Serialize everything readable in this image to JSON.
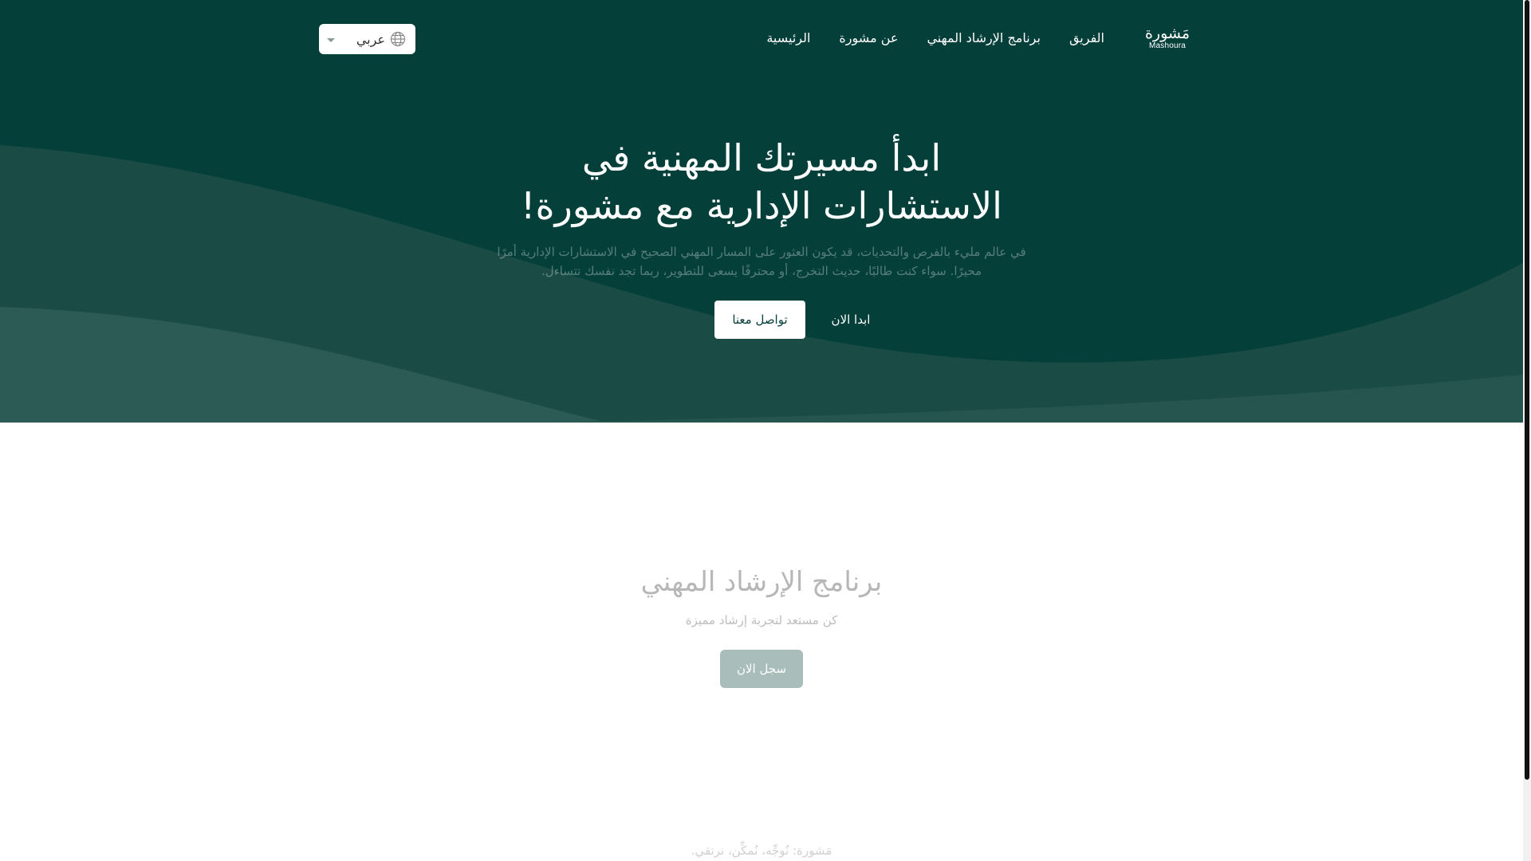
{
  "brand": {
    "name_ar": "مَشورة",
    "name_en": "Mashoura"
  },
  "nav": {
    "items": [
      {
        "label": "الرئيسية"
      },
      {
        "label": "عن مشورة"
      },
      {
        "label": "برنامج الإرشاد المهني"
      },
      {
        "label": "الفريق"
      }
    ],
    "language": {
      "selected": "عربي",
      "icon": "globe-icon"
    }
  },
  "hero": {
    "title_line1": "ابدأ مسيرتك المهنية في",
    "title_line2": "الاستشارات الإدارية مع مشورة!",
    "description_line1": "في عالم مليء بالفرص والتحديات، قد يكون العثور على المسار المهني الصحيح في الاستشارات الإدارية أمرًا",
    "description_line2": "محيرًا. سواء كنت طالبًا، حديث التخرج، أو محترفًا يسعى للتطوير، ربما تجد نفسك تتساءل.",
    "start_button": "ابدا الان",
    "contact_button": "تواصل معنا",
    "colors": {
      "background": "#053f3a",
      "wave": "#2a5a55"
    }
  },
  "program": {
    "title": "برنامج الإرشاد المهني",
    "subtitle": "كن مستعد لتجربة إرشاد مميزة",
    "register_button": "سجل الان"
  },
  "footer": {
    "tagline": "مَشورة: نُوجِّه، نُمكِّن، نرتقي."
  }
}
